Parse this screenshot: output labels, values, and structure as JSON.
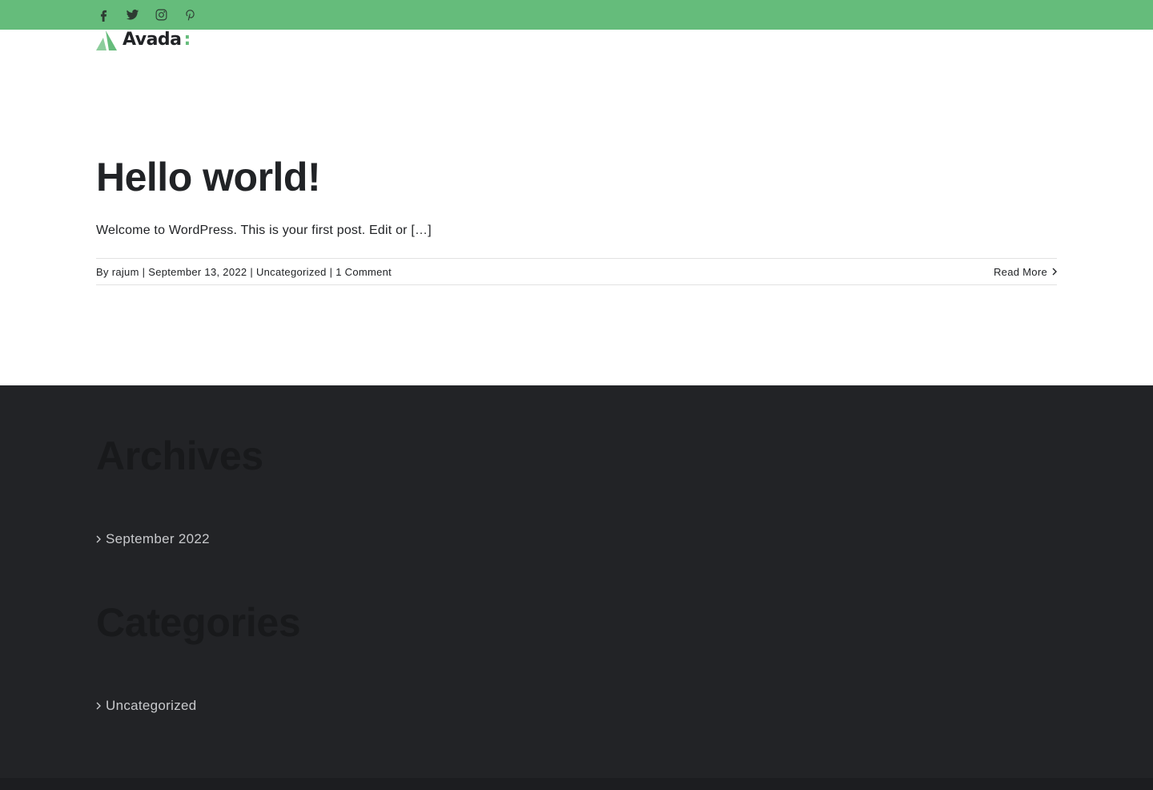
{
  "topbar": {
    "color": "#65bc7b",
    "social_icons": [
      "facebook-icon",
      "twitter-icon",
      "instagram-icon",
      "pinterest-icon"
    ]
  },
  "logo": {
    "text": "Avada",
    "accent": ":",
    "accent_color": "#65bc7b"
  },
  "post": {
    "title": "Hello world!",
    "excerpt": "Welcome to WordPress. This is your first post. Edit or […]",
    "meta": {
      "by": "By ",
      "author": "rajum",
      "sep": " | ",
      "date": "September 13, 2022",
      "category": "Uncategorized",
      "comments": "1 Comment"
    },
    "read_more": "Read More"
  },
  "footer": {
    "background": "#222326",
    "archives": {
      "title": "Archives",
      "items": [
        "September 2022"
      ]
    },
    "categories": {
      "title": "Categories",
      "items": [
        "Uncategorized"
      ]
    }
  }
}
